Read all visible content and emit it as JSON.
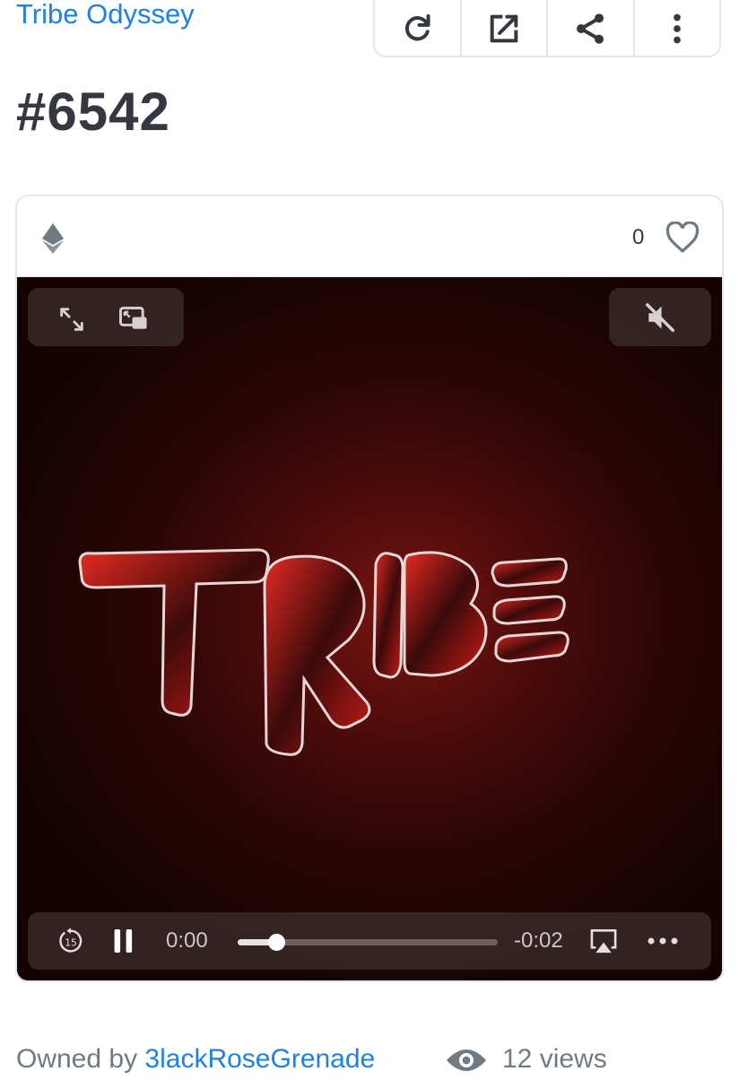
{
  "collection": {
    "name": "Tribe Odyssey"
  },
  "token": {
    "title": "#6542"
  },
  "toolbar": {
    "icons": [
      "refresh-icon",
      "external-link-icon",
      "share-icon",
      "more-vertical-icon"
    ]
  },
  "card": {
    "chain_icon": "ethereum-icon",
    "favorites_count": "0"
  },
  "media": {
    "artwork_text": "TRIBE",
    "player": {
      "skip_back_seconds": "15",
      "current_time": "0:00",
      "remaining_time": "-0:02",
      "progress": 0.15
    }
  },
  "footer": {
    "owned_by_label": "Owned by ",
    "owner": "3lackRoseGrenade",
    "views": "12 views"
  },
  "colors": {
    "link": "#2081e2",
    "text": "#353840",
    "muted": "#707a83",
    "media_bg": "#2a0606",
    "accent_red": "#e02020"
  }
}
